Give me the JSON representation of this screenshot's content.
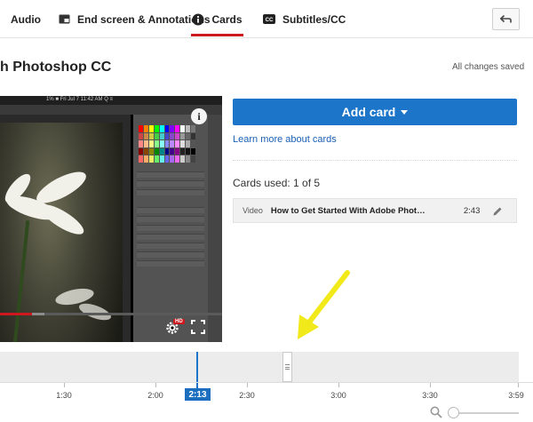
{
  "tabs": [
    {
      "label": "Audio",
      "icon": "audio-icon"
    },
    {
      "label": "End screen & Annotations",
      "icon": "end-screen-icon"
    },
    {
      "label": "Cards",
      "icon": "info-icon",
      "active": true
    },
    {
      "label": "Subtitles/CC",
      "icon": "cc-icon"
    }
  ],
  "header": {
    "video_title": "h Photoshop CC",
    "save_status": "All changes saved"
  },
  "player": {
    "chrome_text": "1% ■  Fri Jul 7 11:42 AM  Q  ≡",
    "hd_badge": "HD",
    "info_glyph": "i",
    "progress_played_fraction": 0.144,
    "progress_buffer_fraction": 0.056
  },
  "cards_panel": {
    "add_card_label": "Add card",
    "learn_more": "Learn more about cards",
    "cards_used": "Cards used: 1 of 5",
    "cards": [
      {
        "type": "Video",
        "title": "How to Get Started With Adobe Photoshop CC",
        "time": "2:43"
      }
    ]
  },
  "timeline": {
    "playhead": "2:13",
    "card_marker": "2:43",
    "ticks": [
      "1:30",
      "2:00",
      "2:30",
      "3:00",
      "3:30",
      "3:59"
    ]
  },
  "colors": {
    "accent_blue": "#1c75c8",
    "tab_underline_red": "#cc181e",
    "annotation_arrow": "#f2e91a"
  }
}
